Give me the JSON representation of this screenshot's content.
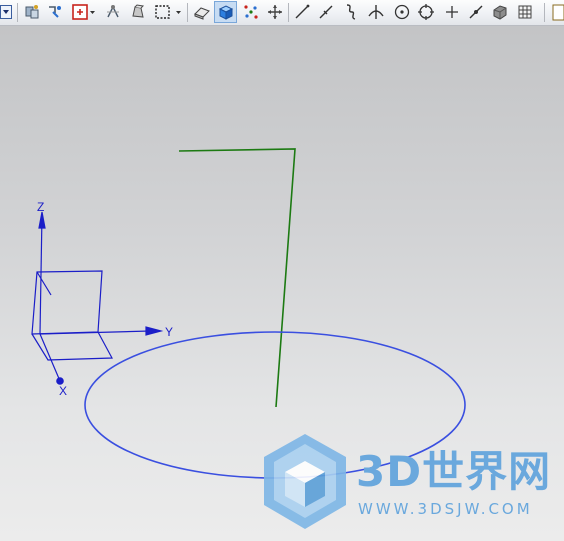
{
  "toolbar": {
    "buttons": [
      {
        "name": "dropdown-arrow-icon",
        "active": false
      },
      {
        "name": "show-hide-icon",
        "active": false
      },
      {
        "name": "snap-point-icon",
        "active": false
      },
      {
        "name": "select-filter-icon",
        "active": false
      },
      {
        "name": "orient-view-icon",
        "active": false
      },
      {
        "name": "pan-icon",
        "active": false
      },
      {
        "name": "box-select-icon",
        "active": false
      },
      {
        "name": "eraser-icon",
        "active": false
      },
      {
        "name": "shaded-cube-icon",
        "active": true
      },
      {
        "name": "snap-grid-icon",
        "active": false
      },
      {
        "name": "move-icon",
        "active": false
      },
      {
        "name": "line-icon",
        "active": false
      },
      {
        "name": "line-point-icon",
        "active": false
      },
      {
        "name": "spline-icon",
        "active": false
      },
      {
        "name": "arc-icon",
        "active": false
      },
      {
        "name": "circle-center-icon",
        "active": false
      },
      {
        "name": "circle-quadrant-icon",
        "active": false
      },
      {
        "name": "plus-point-icon",
        "active": false
      },
      {
        "name": "edge-point-icon",
        "active": false
      },
      {
        "name": "face-icon",
        "active": false
      },
      {
        "name": "grid-icon",
        "active": false
      }
    ]
  },
  "viewport": {
    "axis_labels": {
      "z": "Z",
      "y": "Y",
      "x": "X"
    },
    "colors": {
      "axis": "#1b1ec8",
      "curve": "#1c7a12",
      "circle": "#3a4fe0"
    }
  },
  "watermark": {
    "text": "3D世界网",
    "url": "WWW.3DSJW.COM"
  }
}
